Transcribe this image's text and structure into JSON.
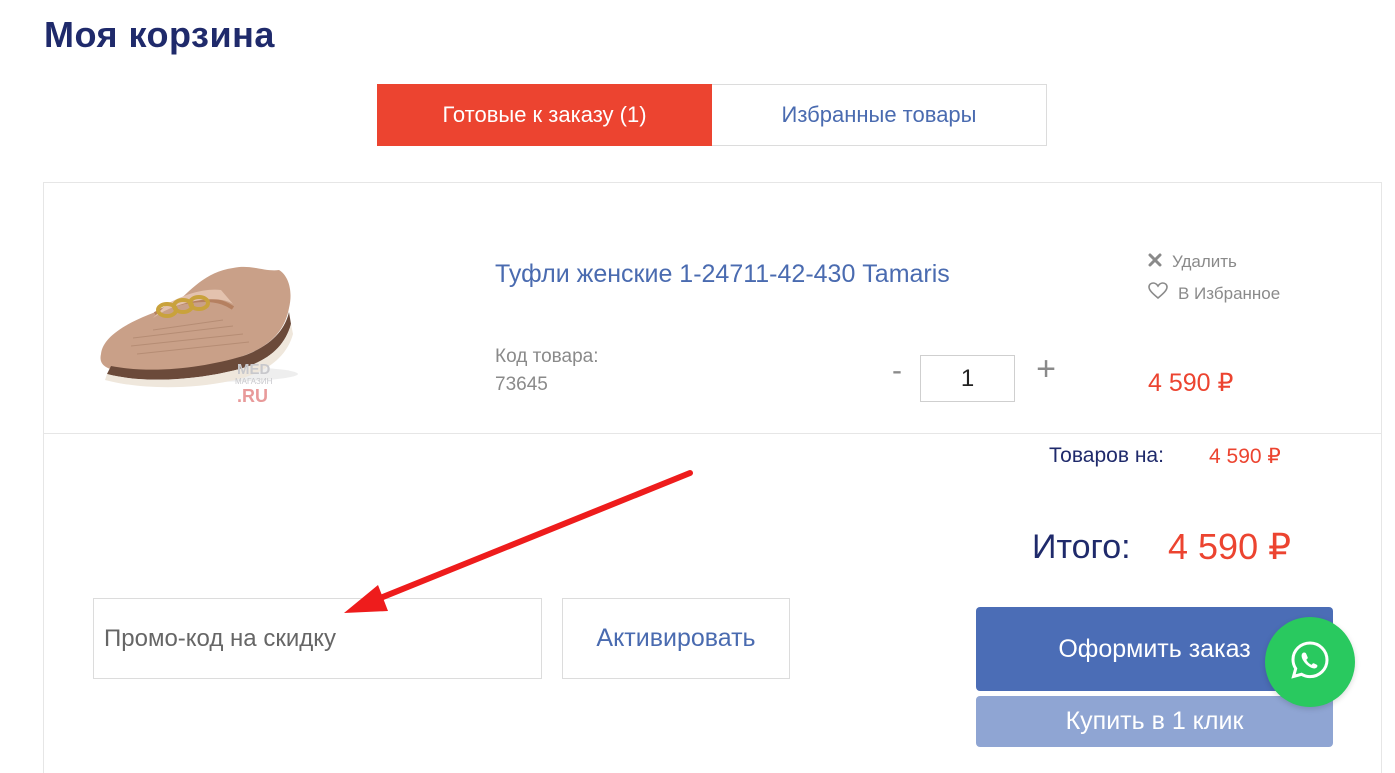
{
  "page": {
    "title": "Моя корзина"
  },
  "tabs": [
    {
      "label": "Готовые к заказу (1)",
      "active": true
    },
    {
      "label": "Избранные товары",
      "active": false
    }
  ],
  "item": {
    "name": "Туфли женские 1-24711-42-430 Tamaris",
    "sku_label": "Код товара:",
    "sku_value": "73645",
    "quantity": "1",
    "minus_label": "-",
    "plus_label": "+",
    "delete_label": "Удалить",
    "favorite_label": "В Избранное",
    "price": "4 590 ₽",
    "image_watermark": {
      "line1": "MED",
      "line2": "МАГАЗИН",
      "line3": ".RU"
    }
  },
  "summary": {
    "subtotal_label": "Товаров на:",
    "subtotal_value": "4 590 ₽",
    "total_label": "Итого:",
    "total_value": "4 590 ₽"
  },
  "promo": {
    "placeholder": "Промо-код на скидку",
    "value": "",
    "activate_label": "Активировать"
  },
  "actions": {
    "order_label": "Оформить заказ",
    "one_click_label": "Купить в 1 клик"
  },
  "colors": {
    "accent_red": "#ec4430",
    "primary_blue": "#4b6db6",
    "light_blue": "#8fa5d3",
    "title_navy": "#1f2a6b",
    "whatsapp_green": "#29c95f"
  },
  "icons": {
    "delete": "close-icon",
    "favorite": "heart-icon",
    "chat": "whatsapp-icon"
  }
}
